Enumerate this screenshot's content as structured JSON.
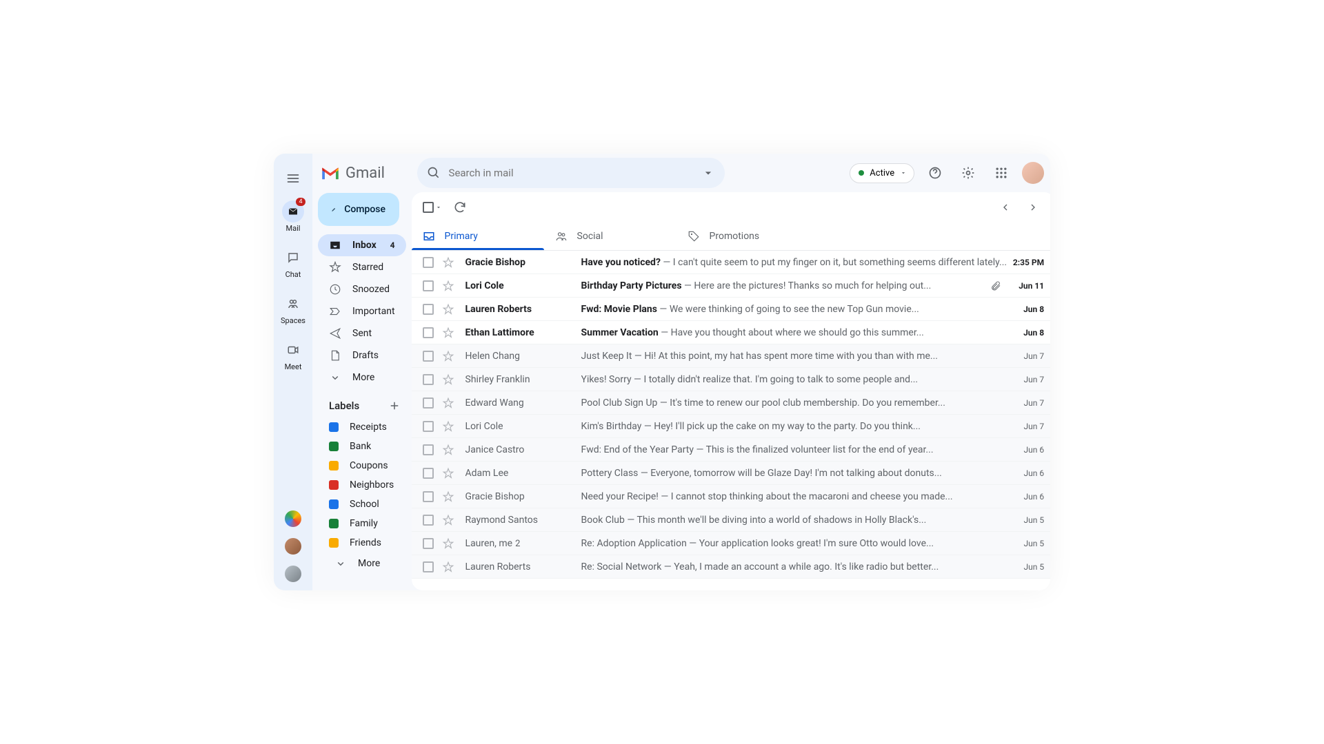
{
  "app": {
    "name": "Gmail"
  },
  "rail": {
    "items": [
      {
        "label": "Mail",
        "badge": "4"
      },
      {
        "label": "Chat"
      },
      {
        "label": "Spaces"
      },
      {
        "label": "Meet"
      }
    ]
  },
  "sidebar": {
    "compose": "Compose",
    "nav": [
      {
        "label": "Inbox",
        "count": "4",
        "active": true
      },
      {
        "label": "Starred"
      },
      {
        "label": "Snoozed"
      },
      {
        "label": "Important"
      },
      {
        "label": "Sent"
      },
      {
        "label": "Drafts"
      },
      {
        "label": "More"
      }
    ],
    "labels_header": "Labels",
    "labels": [
      {
        "label": "Receipts",
        "color": "#1a73e8"
      },
      {
        "label": "Bank",
        "color": "#188038"
      },
      {
        "label": "Coupons",
        "color": "#f9ab00"
      },
      {
        "label": "Neighbors",
        "color": "#d93025"
      },
      {
        "label": "School",
        "color": "#1a73e8"
      },
      {
        "label": "Family",
        "color": "#188038"
      },
      {
        "label": "Friends",
        "color": "#f9ab00"
      }
    ],
    "labels_more": "More"
  },
  "search": {
    "placeholder": "Search in mail"
  },
  "status": {
    "label": "Active"
  },
  "tabs": [
    {
      "label": "Primary",
      "active": true
    },
    {
      "label": "Social"
    },
    {
      "label": "Promotions"
    }
  ],
  "mail": [
    {
      "unread": true,
      "sender": "Gracie Bishop",
      "subject": "Have you noticed?",
      "preview": "I can't quite seem to put my finger on it, but something seems different lately",
      "date": "2:35 PM"
    },
    {
      "unread": true,
      "sender": "Lori Cole",
      "subject": "Birthday Party Pictures",
      "preview": "Here are the pictures! Thanks so much for helping out",
      "date": "Jun 11",
      "attachment": true
    },
    {
      "unread": true,
      "sender": "Lauren Roberts",
      "subject": "Fwd: Movie Plans",
      "preview": "We were thinking of going to see the new Top Gun movie",
      "date": "Jun 8"
    },
    {
      "unread": true,
      "sender": "Ethan Lattimore",
      "subject": "Summer Vacation",
      "preview": "Have you thought about where we should go this summer",
      "date": "Jun 8"
    },
    {
      "unread": false,
      "sender": "Helen Chang",
      "subject": "Just Keep It",
      "preview": "Hi! At this point, my hat has spent more time with you than with me",
      "date": "Jun 7"
    },
    {
      "unread": false,
      "sender": "Shirley Franklin",
      "subject": "Yikes! Sorry",
      "preview": "I totally didn't realize that. I'm going to talk to some people and",
      "date": "Jun 7"
    },
    {
      "unread": false,
      "sender": "Edward Wang",
      "subject": "Pool Club Sign Up",
      "preview": "It's time to renew our pool club membership. Do you remember",
      "date": "Jun 7"
    },
    {
      "unread": false,
      "sender": "Lori Cole",
      "subject": "Kim's Birthday",
      "preview": "Hey! I'll pick up the cake on my way to the party. Do you think",
      "date": "Jun 7"
    },
    {
      "unread": false,
      "sender": "Janice Castro",
      "subject": "Fwd: End of the Year Party",
      "preview": "This is the finalized volunteer list for the end of year",
      "date": "Jun 6"
    },
    {
      "unread": false,
      "sender": "Adam Lee",
      "subject": "Pottery Class",
      "preview": "Everyone, tomorrow will be Glaze Day! I'm not talking about donuts",
      "date": "Jun 6"
    },
    {
      "unread": false,
      "sender": "Gracie Bishop",
      "subject": "Need your Recipe!",
      "preview": "I cannot stop thinking about the macaroni and cheese you made",
      "date": "Jun 6"
    },
    {
      "unread": false,
      "sender": "Raymond Santos",
      "subject": "Book Club",
      "preview": "This month we'll be diving into a world of shadows in Holly Black's",
      "date": "Jun 5"
    },
    {
      "unread": false,
      "sender": "Lauren, me",
      "count": "2",
      "subject": "Re: Adoption Application",
      "preview": "Your application looks great! I'm sure Otto would love",
      "date": "Jun 5"
    },
    {
      "unread": false,
      "sender": "Lauren Roberts",
      "subject": "Re: Social Network",
      "preview": "Yeah, I made an account a while ago. It's like radio but better",
      "date": "Jun 5"
    }
  ]
}
